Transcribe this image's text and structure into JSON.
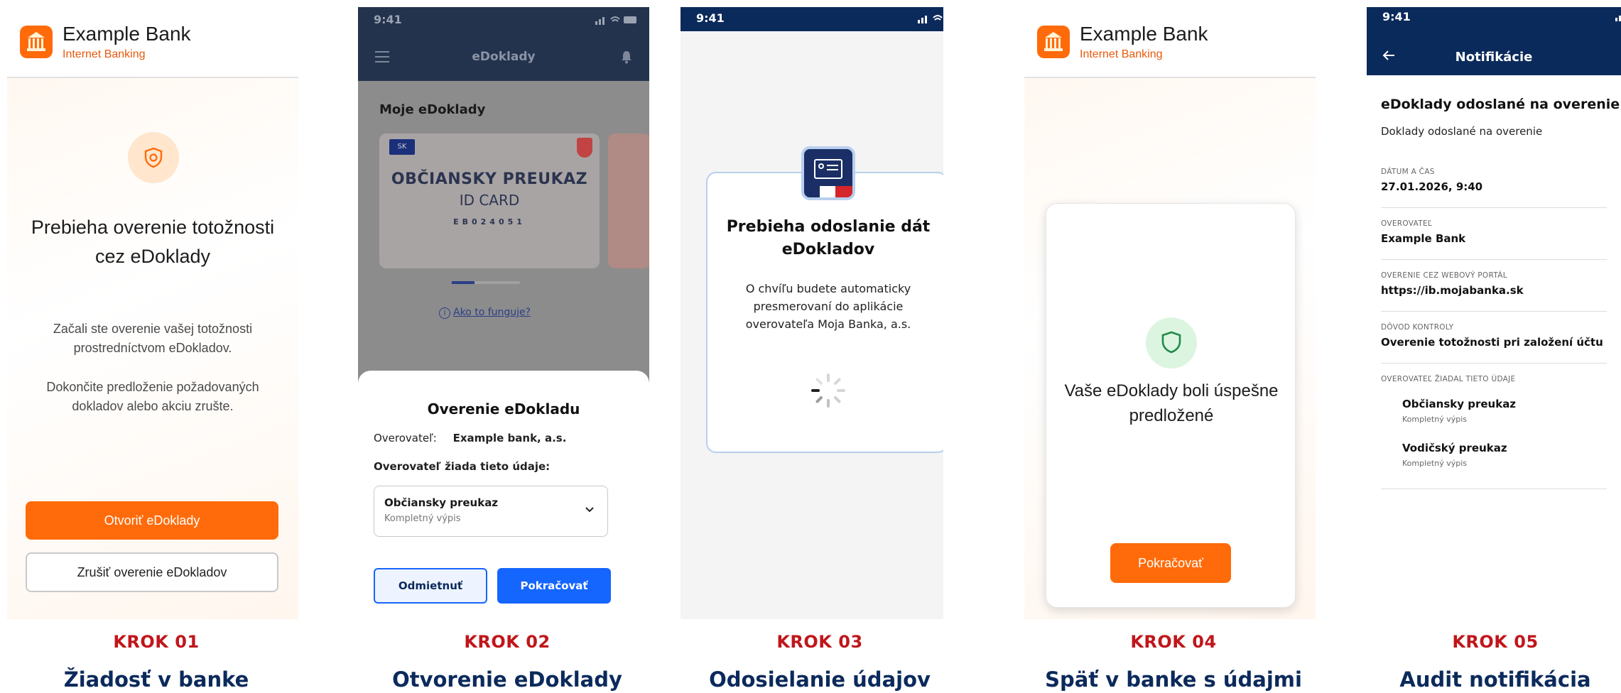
{
  "steps": [
    {
      "step_num": "KROK 01",
      "title": "Žiadosť v banke",
      "bank_name": "Example Bank",
      "bank_sub": "Internet Banking",
      "heading": "Prebieha overenie totožnosti cez eDoklady",
      "paragraph1": "Začali ste overenie vašej totožnosti prostredníctvom eDokladov.",
      "paragraph2": "Dokončite predloženie požadovaných dokladov alebo akciu zrušte.",
      "primary_button": "Otvoriť eDoklady",
      "secondary_button": "Zrušiť overenie eDokladov"
    },
    {
      "step_num": "KROK 02",
      "title": "Otvorenie eDoklady",
      "time": "9:41",
      "nav_title": "eDoklady",
      "section_title": "Moje eDoklady",
      "card_country": "SK",
      "card_title": "OBČIANSKY PREUKAZ",
      "card_subtitle": "ID CARD",
      "card_number": "EB024051",
      "help_link": "Ako to funguje?",
      "sheet_title": "Overenie eDokladu",
      "verifier_label": "Overovateľ:",
      "verifier_value": "Example bank, a.s.",
      "requests_label": "Overovateľ žiada tieto údaje:",
      "doc_title": "Občiansky preukaz",
      "doc_desc": "Kompletný výpis",
      "reject_button": "Odmietnuť",
      "continue_button": "Pokračovať"
    },
    {
      "step_num": "KROK 03",
      "title": "Odosielanie údajov",
      "time": "9:41",
      "heading": "Prebieha odoslanie dát eDokladov",
      "text": "O chvíľu budete automaticky presmerovaní do aplikácie overovateľa Moja Banka, a.s."
    },
    {
      "step_num": "KROK 04",
      "title": "Späť v banke s údajmi",
      "bank_name": "Example Bank",
      "bank_sub": "Internet Banking",
      "heading": "Vaše eDoklady boli úspešne predložené",
      "button": "Pokračovať"
    },
    {
      "step_num": "KROK 05",
      "title": "Audit notifikácia",
      "time": "9:41",
      "nav_title": "Notifikácie",
      "heading": "eDoklady odoslané na overenie",
      "subheading": "Doklady odoslané na overenie",
      "fields": [
        {
          "label": "DÁTUM A ČAS",
          "value": "27.01.2026, 9:40"
        },
        {
          "label": "OVEROVATEĽ",
          "value": "Example Bank"
        },
        {
          "label": "OVERENIE CEZ WEBOVÝ PORTÁL",
          "value": "https://ib.mojabanka.sk"
        },
        {
          "label": "DÔVOD KONTROLY",
          "value": "Overenie totožnosti pri založení účtu"
        }
      ],
      "requested_label": "OVEROVATEĽ ŽIADAL TIETO ÚDAJE",
      "documents": [
        {
          "title": "Občiansky preukaz",
          "desc": "Kompletný výpis"
        },
        {
          "title": "Vodičský preukaz",
          "desc": "Kompletný výpis"
        }
      ]
    }
  ],
  "colors": {
    "bank_orange": "#ff6b0a",
    "navy": "#0b2a5c",
    "step_red": "#c0161b",
    "primary_blue": "#1565ff",
    "success_green": "#1f8a4a"
  }
}
